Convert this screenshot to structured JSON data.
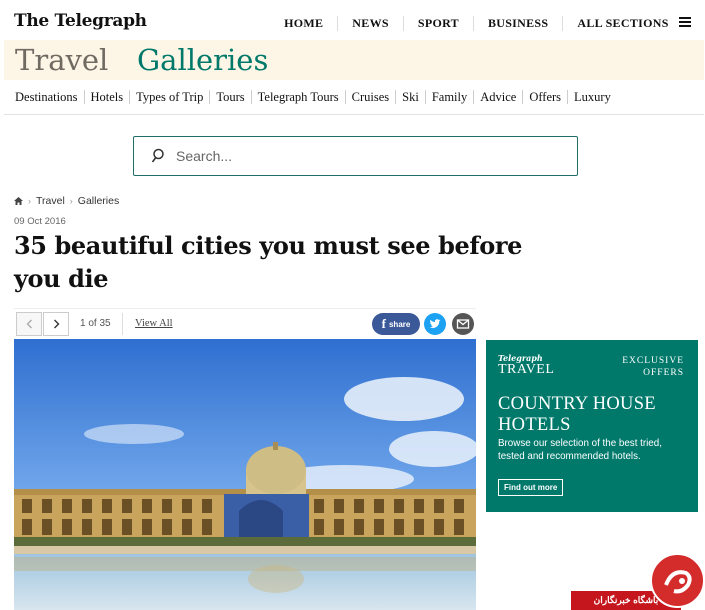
{
  "header": {
    "logo": "The Telegraph",
    "nav": [
      "HOME",
      "NEWS",
      "SPORT",
      "BUSINESS",
      "ALL SECTIONS"
    ]
  },
  "section": {
    "name": "Travel",
    "subsection": "Galleries"
  },
  "subnav": [
    "Destinations",
    "Hotels",
    "Types of Trip",
    "Tours",
    "Telegraph Tours",
    "Cruises",
    "Ski",
    "Family",
    "Advice",
    "Offers",
    "Luxury"
  ],
  "search": {
    "placeholder": "Search..."
  },
  "breadcrumb": [
    "Travel",
    "Galleries"
  ],
  "article": {
    "date": "09 Oct 2016",
    "title": "35 beautiful cities you must see before you die"
  },
  "gallery": {
    "counter": "1 of 35",
    "view_all": "View All",
    "share_label": "share"
  },
  "ad": {
    "brand_top": "Telegraph",
    "brand_bottom": "TRAVEL",
    "tag_line1": "EXCLUSIVE",
    "tag_line2": "OFFERS",
    "headline": "COUNTRY HOUSE HOTELS",
    "description": "Browse our selection of the best tried, tested and recommended hotels.",
    "button": "Find out more"
  },
  "watermark": {
    "text": "باشگاه خبرنگاران"
  },
  "colors": {
    "accent": "#00796b",
    "band": "#fdf6e6",
    "facebook": "#3b5998",
    "twitter": "#1da1f2"
  }
}
